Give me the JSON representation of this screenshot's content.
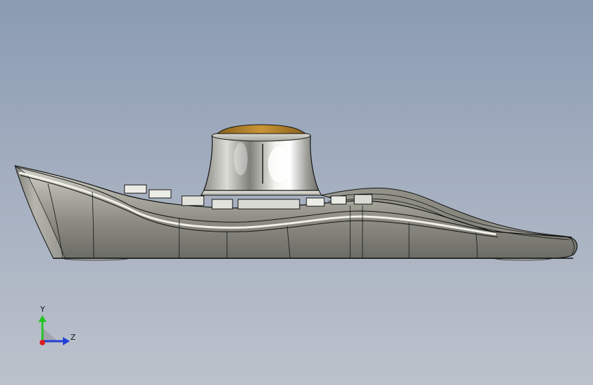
{
  "viewport": {
    "background_top": "#8a9bb2",
    "background_bottom": "#bcc2cc"
  },
  "model": {
    "body_color": "#8f8f85",
    "knob_color": "#c8c8c2",
    "knob_cap_color": "#b8892e",
    "edge_color": "#111111"
  },
  "triad": {
    "y_label": "Y",
    "z_label": "Z",
    "y_color": "#26c426",
    "z_color": "#1f3fd6",
    "x_color": "#d81e1e"
  }
}
